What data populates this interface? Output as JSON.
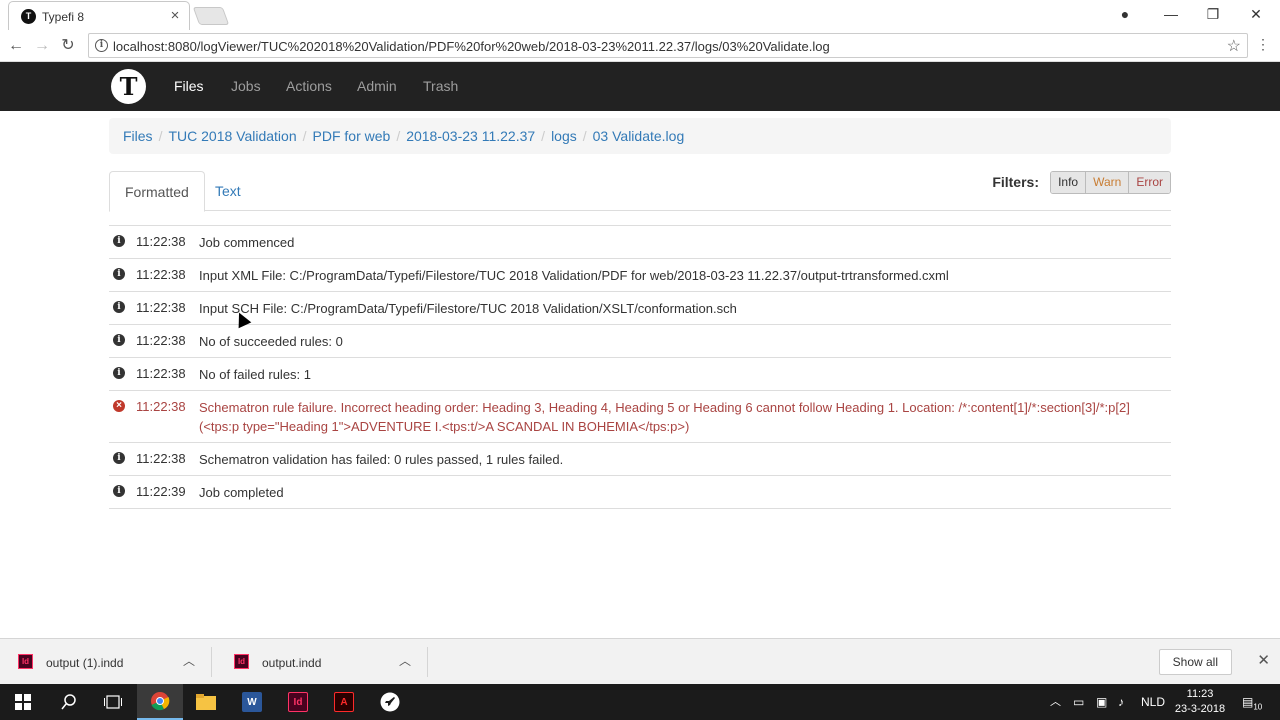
{
  "browser": {
    "tab_title": "Typefi 8",
    "favicon": "T",
    "url": "localhost:8080/logViewer/TUC%202018%20Validation/PDF%20for%20web/2018-03-23%2011.22.37/logs/03%20Validate.log"
  },
  "navbar": {
    "logo": "T",
    "items": [
      {
        "label": "Files"
      },
      {
        "label": "Jobs"
      },
      {
        "label": "Actions"
      },
      {
        "label": "Admin"
      },
      {
        "label": "Trash"
      }
    ]
  },
  "breadcrumb": [
    "Files",
    "TUC 2018 Validation",
    "PDF for web",
    "2018-03-23 11.22.37",
    "logs",
    "03 Validate.log"
  ],
  "view_tabs": [
    {
      "label": "Formatted"
    },
    {
      "label": "Text"
    }
  ],
  "filters": {
    "label": "Filters:",
    "buttons": [
      {
        "label": "Info"
      },
      {
        "label": "Warn"
      },
      {
        "label": "Error"
      }
    ]
  },
  "log_entries": [
    {
      "level": "info",
      "time": "11:22:38",
      "message": "Job commenced"
    },
    {
      "level": "info",
      "time": "11:22:38",
      "message": "Input XML File: C:/ProgramData/Typefi/Filestore/TUC 2018 Validation/PDF for web/2018-03-23 11.22.37/output-trtransformed.cxml"
    },
    {
      "level": "info",
      "time": "11:22:38",
      "message": "Input SCH File: C:/ProgramData/Typefi/Filestore/TUC 2018 Validation/XSLT/conformation.sch"
    },
    {
      "level": "info",
      "time": "11:22:38",
      "message": "No of succeeded rules: 0"
    },
    {
      "level": "info",
      "time": "11:22:38",
      "message": "No of failed rules: 1"
    },
    {
      "level": "error",
      "time": "11:22:38",
      "message": "Schematron rule failure. Incorrect heading order: Heading 3, Heading 4, Heading 5 or Heading 6 cannot follow Heading 1. Location: /*:content[1]/*:section[3]/*:p[2] (<tps:p type=\"Heading 1\">ADVENTURE I.<tps:t/>A SCANDAL IN BOHEMIA</tps:p>)"
    },
    {
      "level": "info",
      "time": "11:22:38",
      "message": "Schematron validation has failed: 0 rules passed, 1 rules failed."
    },
    {
      "level": "info",
      "time": "11:22:39",
      "message": "Job completed"
    }
  ],
  "downloads": {
    "items": [
      {
        "name": "output (1).indd",
        "icon": "Id"
      },
      {
        "name": "output.indd",
        "icon": "Id"
      }
    ],
    "show_all": "Show all"
  },
  "taskbar": {
    "language": "NLD",
    "time": "11:23",
    "date": "23-3-2018",
    "notifications": "10",
    "apps": [
      {
        "name": "chrome-icon"
      },
      {
        "name": "file-explorer-icon"
      },
      {
        "name": "word-icon",
        "glyph": "W"
      },
      {
        "name": "indesign-icon",
        "glyph": "Id"
      },
      {
        "name": "acrobat-icon",
        "glyph": "A"
      },
      {
        "name": "rocket-icon"
      }
    ]
  },
  "colors": {
    "navbar_bg": "#222222",
    "link": "#337ab7",
    "error": "#a94442",
    "warn": "#c87d33"
  }
}
